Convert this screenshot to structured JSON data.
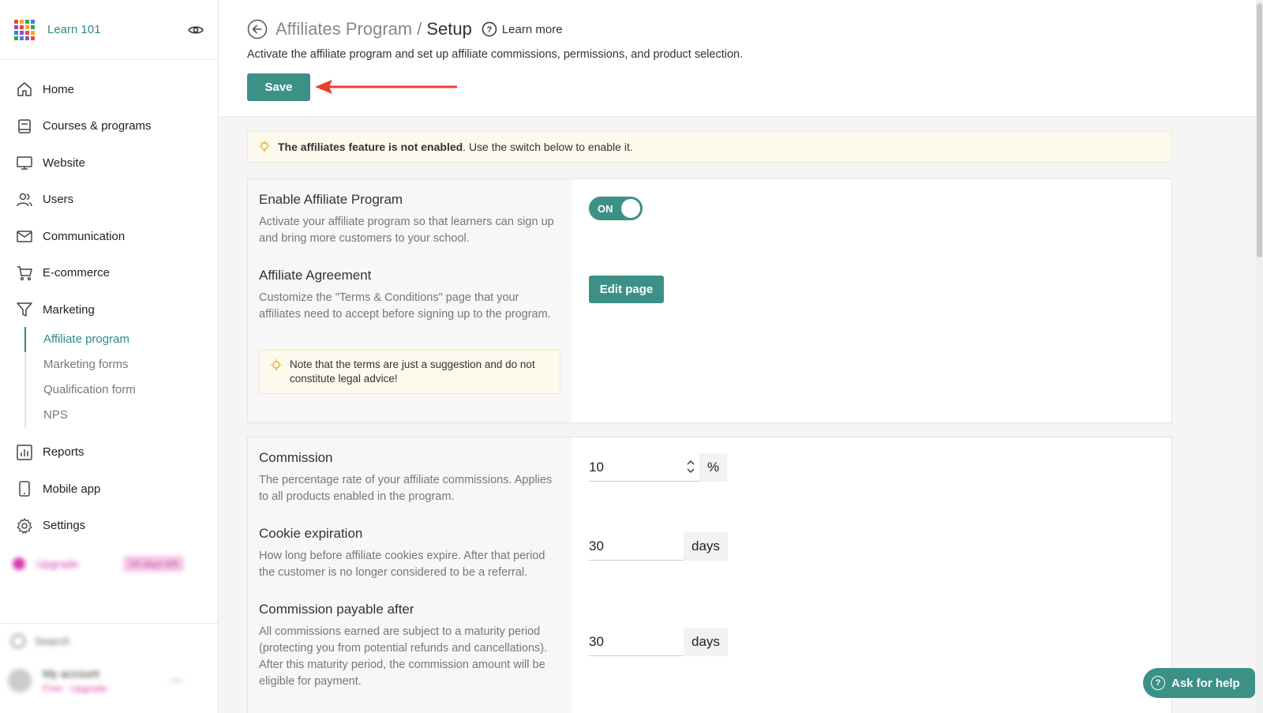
{
  "brand": {
    "name": "Learn 101",
    "grid_colors": [
      "#e84a3b",
      "#f6a623",
      "#2fa84f",
      "#3e7fd8",
      "#8c52c6",
      "#e84a3b",
      "#f6a623",
      "#2fa84f",
      "#3e7fd8",
      "#8c52c6",
      "#e84a3b",
      "#f6a623",
      "#2fa84f",
      "#3e7fd8",
      "#8c52c6",
      "#e84a3b"
    ]
  },
  "sidebar": {
    "items": [
      {
        "label": "Home",
        "icon": "home-icon"
      },
      {
        "label": "Courses & programs",
        "icon": "book-icon"
      },
      {
        "label": "Website",
        "icon": "monitor-icon"
      },
      {
        "label": "Users",
        "icon": "users-icon"
      },
      {
        "label": "Communication",
        "icon": "mail-icon"
      },
      {
        "label": "E-commerce",
        "icon": "cart-icon"
      },
      {
        "label": "Marketing",
        "icon": "funnel-icon"
      }
    ],
    "marketing_sub": [
      {
        "label": "Affiliate program",
        "active": true
      },
      {
        "label": "Marketing forms",
        "active": false
      },
      {
        "label": "Qualification form",
        "active": false
      },
      {
        "label": "NPS",
        "active": false
      }
    ],
    "items_after": [
      {
        "label": "Reports",
        "icon": "chart-icon"
      },
      {
        "label": "Mobile app",
        "icon": "mobile-icon"
      },
      {
        "label": "Settings",
        "icon": "gear-icon"
      }
    ],
    "upgrade": {
      "label": "Upgrade",
      "badge": "24 days left"
    },
    "search_label": "Search",
    "account": {
      "name": "My account",
      "plan": "Free - Upgrade"
    }
  },
  "header": {
    "title_parent": "Affiliates Program",
    "title_separator": "/",
    "title_current": "Setup",
    "learn_more": "Learn more",
    "subtitle": "Activate the affiliate program and set up affiliate commissions, permissions, and product selection.",
    "save_label": "Save"
  },
  "banner": {
    "bold": "The affiliates feature is not enabled",
    "rest": ". Use the switch below to enable it."
  },
  "enable_section": {
    "title": "Enable Affiliate Program",
    "desc": "Activate your affiliate program so that learners can sign up and bring more customers to your school.",
    "toggle_label": "ON"
  },
  "agreement_section": {
    "title": "Affiliate Agreement",
    "desc": "Customize the \"Terms & Conditions\" page that your affiliates need to accept before signing up to the program.",
    "button": "Edit page",
    "note": "Note that the terms are just a suggestion and do not constitute legal advice!"
  },
  "commission": {
    "title": "Commission",
    "desc": "The percentage rate of your affiliate commissions. Applies to all products enabled in the program.",
    "value": "10",
    "unit": "%"
  },
  "cookie": {
    "title": "Cookie expiration",
    "desc": "How long before affiliate cookies expire. After that period the customer is no longer considered to be a referral.",
    "value": "30",
    "unit": "days"
  },
  "payable": {
    "title": "Commission payable after",
    "desc": "All commissions earned are subject to a maturity period (protecting you from potential refunds and cancellations). After this maturity period, the commission amount will be eligible for payment.",
    "value": "30",
    "unit": "days"
  },
  "help": {
    "label": "Ask for help"
  },
  "colors": {
    "accent": "#3c9187",
    "brand_text": "#2e8b84",
    "arrow": "#e8412c"
  }
}
